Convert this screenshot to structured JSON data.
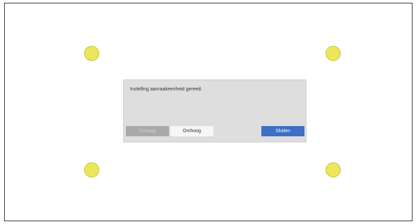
{
  "dialog": {
    "message": "Instelling aanraakeenheid gereed.",
    "buttons": {
      "down": "Omlaag",
      "up": "Omhoog",
      "close": "Sluiten"
    }
  },
  "colors": {
    "target": "#ece65a",
    "close_button": "#3f6fc4",
    "disabled_button": "#a9a9a9"
  }
}
